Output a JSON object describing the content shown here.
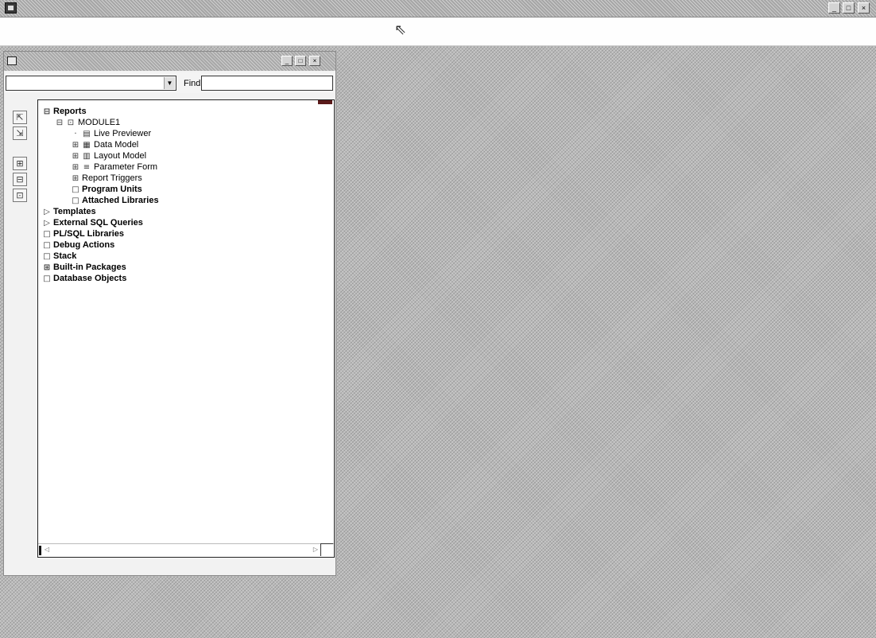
{
  "app": {
    "title": "",
    "icon": "report-builder-app-icon",
    "caption_buttons": [
      "_",
      "□",
      "×"
    ]
  },
  "navigator": {
    "title": "",
    "icon": "object-navigator-icon",
    "caption_buttons": [
      "_",
      "□",
      "×"
    ],
    "toolbar": {
      "combo_value": "",
      "find_label": "Find:",
      "find_value": ""
    },
    "tree": [
      {
        "label": "Reports",
        "depth": 0,
        "bold": true,
        "expander": "⊟",
        "icon": ""
      },
      {
        "label": "MODULE1",
        "depth": 1,
        "bold": false,
        "expander": "⊟",
        "icon": "⊡"
      },
      {
        "label": "Live Previewer",
        "depth": 2,
        "bold": false,
        "expander": "·",
        "icon": "▤"
      },
      {
        "label": "Data Model",
        "depth": 2,
        "bold": false,
        "expander": "⊞",
        "icon": "▦"
      },
      {
        "label": "Layout Model",
        "depth": 2,
        "bold": false,
        "expander": "⊞",
        "icon": "▥"
      },
      {
        "label": "Parameter Form",
        "depth": 2,
        "bold": false,
        "expander": "⊞",
        "icon": "≡"
      },
      {
        "label": "Report Triggers",
        "depth": 2,
        "bold": false,
        "expander": "⊞",
        "icon": ""
      },
      {
        "label": "Program Units",
        "depth": 2,
        "bold": true,
        "expander": "□",
        "icon": ""
      },
      {
        "label": "Attached Libraries",
        "depth": 2,
        "bold": true,
        "expander": "□",
        "icon": ""
      },
      {
        "label": "Templates",
        "depth": 0,
        "bold": true,
        "expander": "▷",
        "icon": ""
      },
      {
        "label": "External SQL Queries",
        "depth": 0,
        "bold": true,
        "expander": "▷",
        "icon": ""
      },
      {
        "label": "PL/SQL Libraries",
        "depth": 0,
        "bold": true,
        "expander": "□",
        "icon": ""
      },
      {
        "label": "Debug Actions",
        "depth": 0,
        "bold": true,
        "expander": "□",
        "icon": ""
      },
      {
        "label": "Stack",
        "depth": 0,
        "bold": true,
        "expander": "□",
        "icon": ""
      },
      {
        "label": "Built-in Packages",
        "depth": 0,
        "bold": true,
        "expander": "⊞",
        "icon": ""
      },
      {
        "label": "Database Objects",
        "depth": 0,
        "bold": true,
        "expander": "□",
        "icon": ""
      }
    ],
    "side_tools": [
      {
        "name": "expand-tool-icon",
        "glyph": "⇱"
      },
      {
        "name": "collapse-tool-icon",
        "glyph": "⇲"
      },
      {
        "name": "expand-all-tool-icon",
        "glyph": "⊞"
      },
      {
        "name": "collapse-all-tool-icon",
        "glyph": "⊟"
      },
      {
        "name": "create-tool-icon",
        "glyph": "⊡"
      }
    ]
  },
  "colors": {
    "desktop": "#b9b9b9",
    "titlebar": "#a8a8a8",
    "tree_background": "#ffffff"
  }
}
